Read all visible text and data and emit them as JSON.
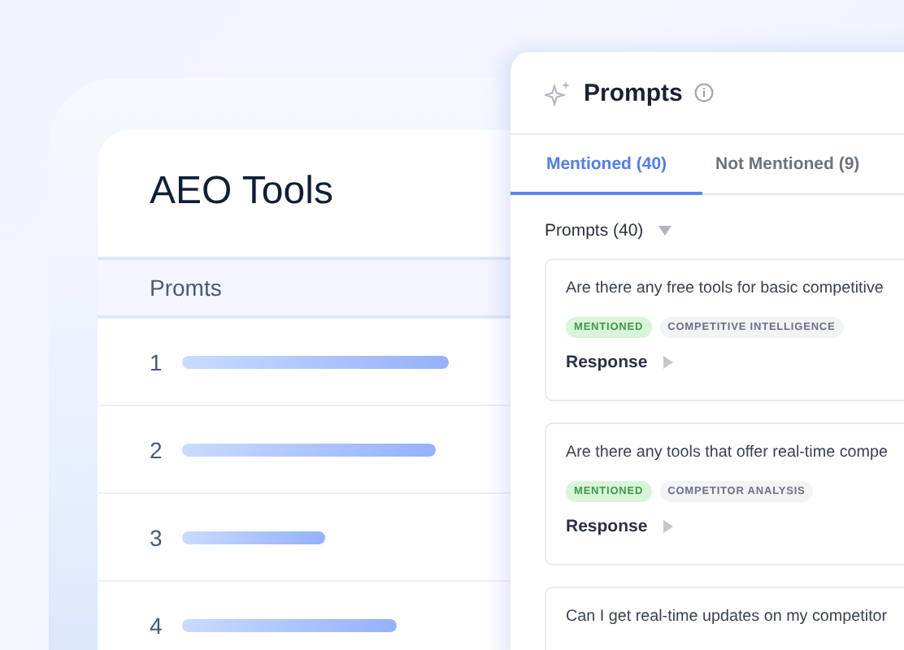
{
  "tools_card": {
    "title": "AEO Tools",
    "column": "Promts",
    "rows": [
      {
        "number": "1"
      },
      {
        "number": "2"
      },
      {
        "number": "3"
      },
      {
        "number": "4"
      }
    ]
  },
  "prompts_panel": {
    "title": "Prompts",
    "tabs": [
      {
        "label": "Mentioned (40)",
        "selected": true
      },
      {
        "label": "Not Mentioned (9)",
        "selected": false
      }
    ],
    "filter": "Prompts (40)",
    "cards": [
      {
        "question": "Are there any free tools for basic competitive",
        "tags": [
          {
            "label": "MENTIONED",
            "kind": "status"
          },
          {
            "label": "COMPETITIVE INTELLIGENCE",
            "kind": "topic"
          }
        ],
        "response": "Response"
      },
      {
        "question": "Are there any tools that offer real-time compe",
        "tags": [
          {
            "label": "MENTIONED",
            "kind": "status"
          },
          {
            "label": "COMPETITOR ANALYSIS",
            "kind": "topic"
          }
        ],
        "response": "Response"
      },
      {
        "question": "Can I get real-time updates on my competitor"
      }
    ]
  }
}
